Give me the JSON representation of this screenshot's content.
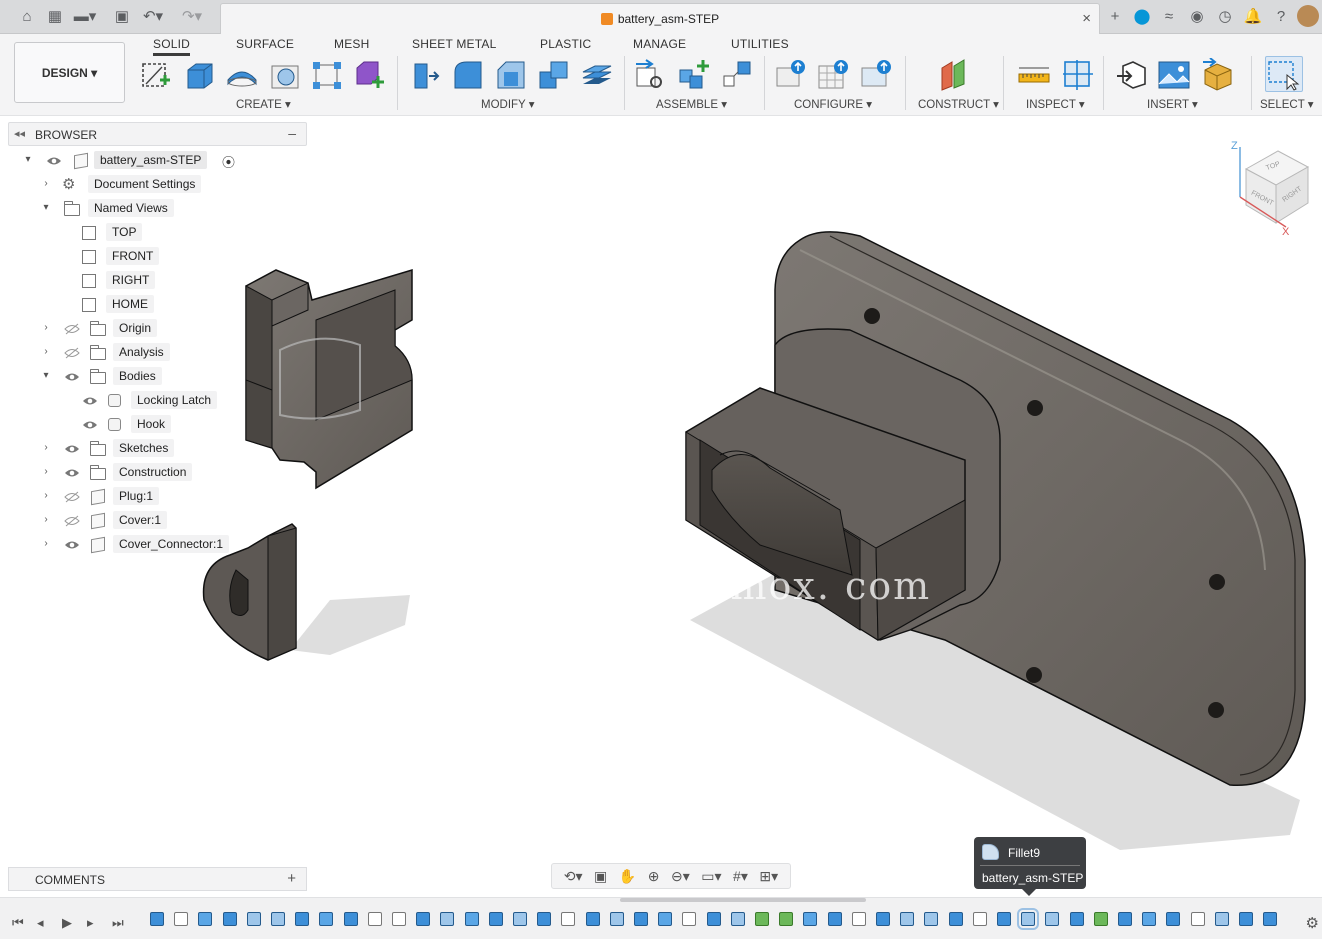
{
  "window": {
    "document_title": "battery_asm-STEP",
    "close_tab": "×",
    "top_icons": [
      "home-icon",
      "grid-icon",
      "file-icon",
      "save-icon",
      "undo-icon",
      "redo-icon"
    ],
    "right_icons": [
      "new-tab-icon",
      "extensions-icon",
      "job-status-icon",
      "online-status-icon",
      "clock-icon",
      "notifications-icon",
      "help-icon",
      "avatar"
    ]
  },
  "workspace": {
    "design_label": "DESIGN"
  },
  "tabs": [
    {
      "label": "SOLID",
      "active": true
    },
    {
      "label": "SURFACE",
      "active": false
    },
    {
      "label": "MESH",
      "active": false
    },
    {
      "label": "SHEET METAL",
      "active": false
    },
    {
      "label": "PLASTIC",
      "active": false
    },
    {
      "label": "MANAGE",
      "active": false
    },
    {
      "label": "UTILITIES",
      "active": false
    }
  ],
  "groups": {
    "create": "CREATE",
    "modify": "MODIFY",
    "assemble": "ASSEMBLE",
    "configure": "CONFIGURE",
    "construct": "CONSTRUCT",
    "inspect": "INSPECT",
    "insert": "INSERT",
    "select": "SELECT"
  },
  "browser": {
    "title": "BROWSER",
    "root": "battery_asm-STEP",
    "items": {
      "document_settings": "Document Settings",
      "named_views": "Named Views",
      "top": "TOP",
      "front": "FRONT",
      "right": "RIGHT",
      "home": "HOME",
      "origin": "Origin",
      "analysis": "Analysis",
      "bodies": "Bodies",
      "locking_latch": "Locking Latch",
      "hook": "Hook",
      "sketches": "Sketches",
      "construction": "Construction",
      "plug": "Plug:1",
      "cover": "Cover:1",
      "cover_connector": "Cover_Connector:1"
    }
  },
  "comments": {
    "title": "COMMENTS",
    "add": "+"
  },
  "viewcube": {
    "top": "TOP",
    "front": "FRONT",
    "right": "RIGHT",
    "axis_z": "Z",
    "axis_x": "X"
  },
  "watermark": "3dmox. com",
  "tooltip": {
    "feature": "Fillet9",
    "document": "battery_asm-STEP"
  },
  "colors": {
    "accent": "#0696d7",
    "body": "#6e6a66",
    "ribbon_bg": "#f4f4f5"
  }
}
